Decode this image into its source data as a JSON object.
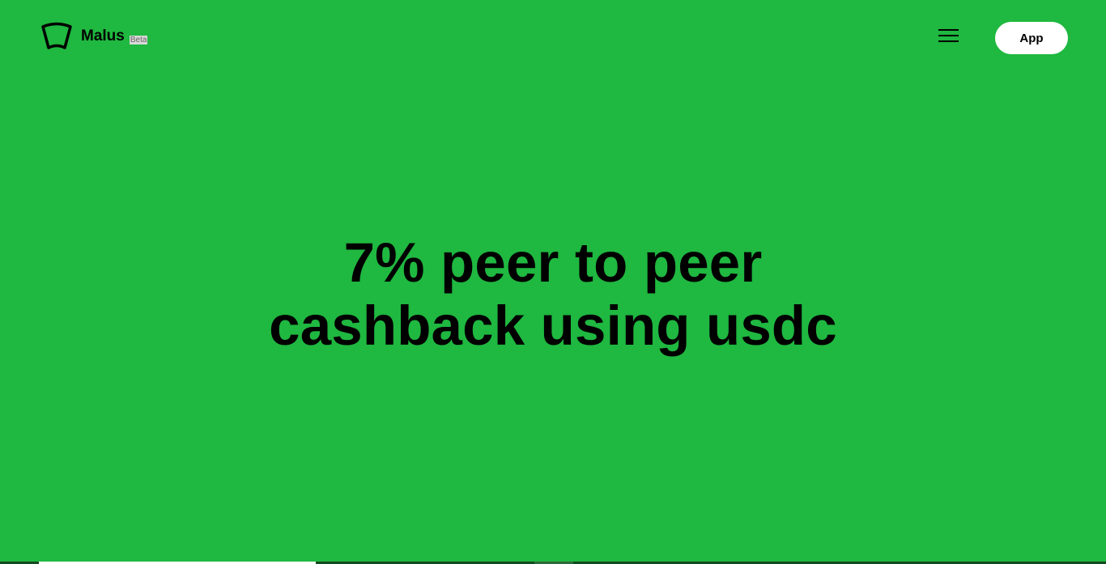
{
  "header": {
    "logo_icon": "windshield-logo-icon",
    "brand_name": "Malus",
    "beta_label": "Beta",
    "menu_icon": "hamburger-menu-icon",
    "app_button_label": "App"
  },
  "hero": {
    "line1": "7% peer to peer",
    "line2": "cashback using usdc"
  },
  "slide_progress": 0.25,
  "colors": {
    "background": "#1fb840",
    "text": "#000000",
    "button_bg": "#ffffff"
  }
}
